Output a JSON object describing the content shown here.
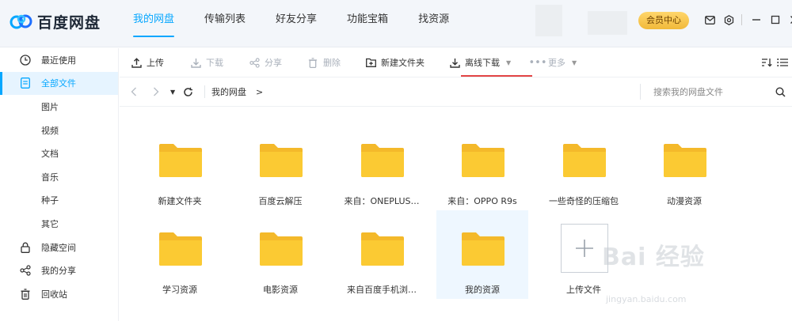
{
  "app": {
    "name": "百度网盘",
    "brand_color": "#06a7ff",
    "folder_color": "#f7c427"
  },
  "nav": {
    "items": [
      {
        "label": "我的网盘",
        "active": true
      },
      {
        "label": "传输列表",
        "active": false
      },
      {
        "label": "好友分享",
        "active": false
      },
      {
        "label": "功能宝箱",
        "active": false
      },
      {
        "label": "找资源",
        "active": false
      }
    ],
    "vip_label": "会员中心"
  },
  "sidebar": {
    "items": [
      {
        "label": "最近使用",
        "icon": "clock-icon"
      },
      {
        "label": "全部文件",
        "icon": "file-icon",
        "active": true
      },
      {
        "label": "图片"
      },
      {
        "label": "视频"
      },
      {
        "label": "文档"
      },
      {
        "label": "音乐"
      },
      {
        "label": "种子"
      },
      {
        "label": "其它"
      },
      {
        "label": "隐藏空间",
        "icon": "lock-icon"
      },
      {
        "label": "我的分享",
        "icon": "share-icon"
      },
      {
        "label": "回收站",
        "icon": "trash-icon"
      }
    ]
  },
  "toolbar": {
    "upload": "上传",
    "download": "下载",
    "share": "分享",
    "delete": "删除",
    "new_folder": "新建文件夹",
    "offline_download": "离线下载",
    "more": "更多"
  },
  "breadcrumb": {
    "path": "我的网盘",
    "separator": ">",
    "search_placeholder": "搜索我的网盘文件"
  },
  "files": [
    {
      "name": "新建文件夹"
    },
    {
      "name": "百度云解压"
    },
    {
      "name": "来自：ONEPLUS…"
    },
    {
      "name": "来自：OPPO R9s"
    },
    {
      "name": "一些奇怪的压缩包"
    },
    {
      "name": "动漫资源"
    },
    {
      "name": "学习资源"
    },
    {
      "name": "电影资源"
    },
    {
      "name": "来自百度手机浏…"
    },
    {
      "name": "我的资源"
    }
  ],
  "upload_tile": {
    "label": "上传文件"
  },
  "watermark": {
    "main": "Bai 经验",
    "sub": "jingyan.baidu.com"
  }
}
